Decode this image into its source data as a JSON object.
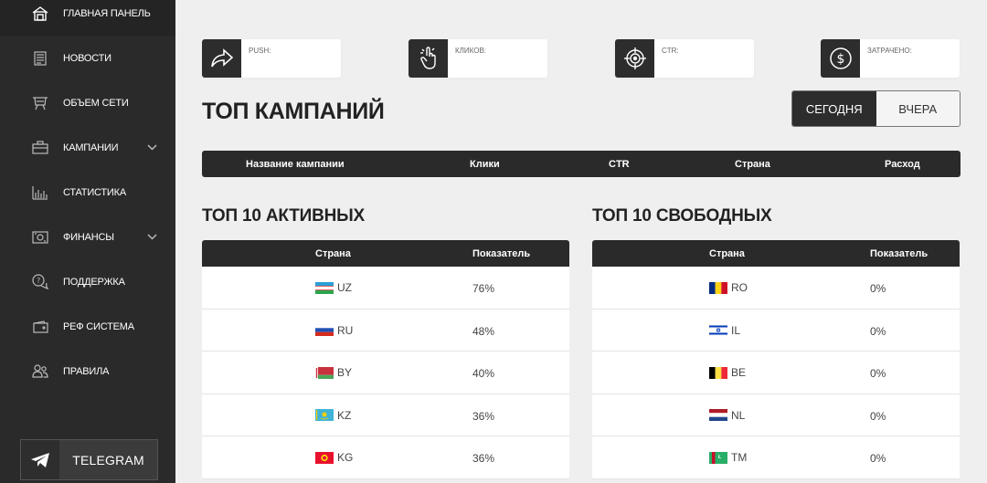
{
  "sidebar": {
    "items": [
      {
        "label": "ГЛАВНАЯ ПАНЕЛЬ",
        "icon": "home-icon",
        "active": true
      },
      {
        "label": "НОВОСТИ",
        "icon": "news-icon"
      },
      {
        "label": "ОБЪЕМ СЕТИ",
        "icon": "network-icon"
      },
      {
        "label": "КАМПАНИИ",
        "icon": "briefcase-icon",
        "chevron": true
      },
      {
        "label": "СТАТИСТИКА",
        "icon": "bar-chart-icon"
      },
      {
        "label": "ФИНАНСЫ",
        "icon": "money-icon",
        "chevron": true
      },
      {
        "label": "ПОДДЕРЖКА",
        "icon": "support-icon"
      },
      {
        "label": "РЕФ СИСТЕМА",
        "icon": "wallet-icon"
      },
      {
        "label": "ПРАВИЛА",
        "icon": "users-icon"
      }
    ],
    "telegram_label": "TELEGRAM"
  },
  "stats": [
    {
      "label": "PUSH:",
      "icon": "share-arrow-icon"
    },
    {
      "label": "КЛИКОВ:",
      "icon": "tap-hand-icon"
    },
    {
      "label": "CTR:",
      "icon": "target-icon"
    },
    {
      "label": "ЗАТРАЧЕНО:",
      "icon": "dollar-icon"
    }
  ],
  "campaigns": {
    "title": "ТОП КАМПАНИЙ",
    "toggle": {
      "today": "СЕГОДНЯ",
      "yesterday": "ВЧЕРА"
    },
    "columns": [
      "Название кампании",
      "Клики",
      "CTR",
      "Страна",
      "Расход"
    ]
  },
  "top_active": {
    "title": "ТОП 10 АКТИВНЫХ",
    "columns": [
      "Страна",
      "Показатель"
    ],
    "rows": [
      {
        "code": "UZ",
        "value": "76%"
      },
      {
        "code": "RU",
        "value": "48%"
      },
      {
        "code": "BY",
        "value": "40%"
      },
      {
        "code": "KZ",
        "value": "36%"
      },
      {
        "code": "KG",
        "value": "36%"
      }
    ]
  },
  "top_free": {
    "title": "ТОП 10 СВОБОДНЫХ",
    "columns": [
      "Страна",
      "Показатель"
    ],
    "rows": [
      {
        "code": "RO",
        "value": "0%"
      },
      {
        "code": "IL",
        "value": "0%"
      },
      {
        "code": "BE",
        "value": "0%"
      },
      {
        "code": "NL",
        "value": "0%"
      },
      {
        "code": "TM",
        "value": "0%"
      }
    ]
  }
}
